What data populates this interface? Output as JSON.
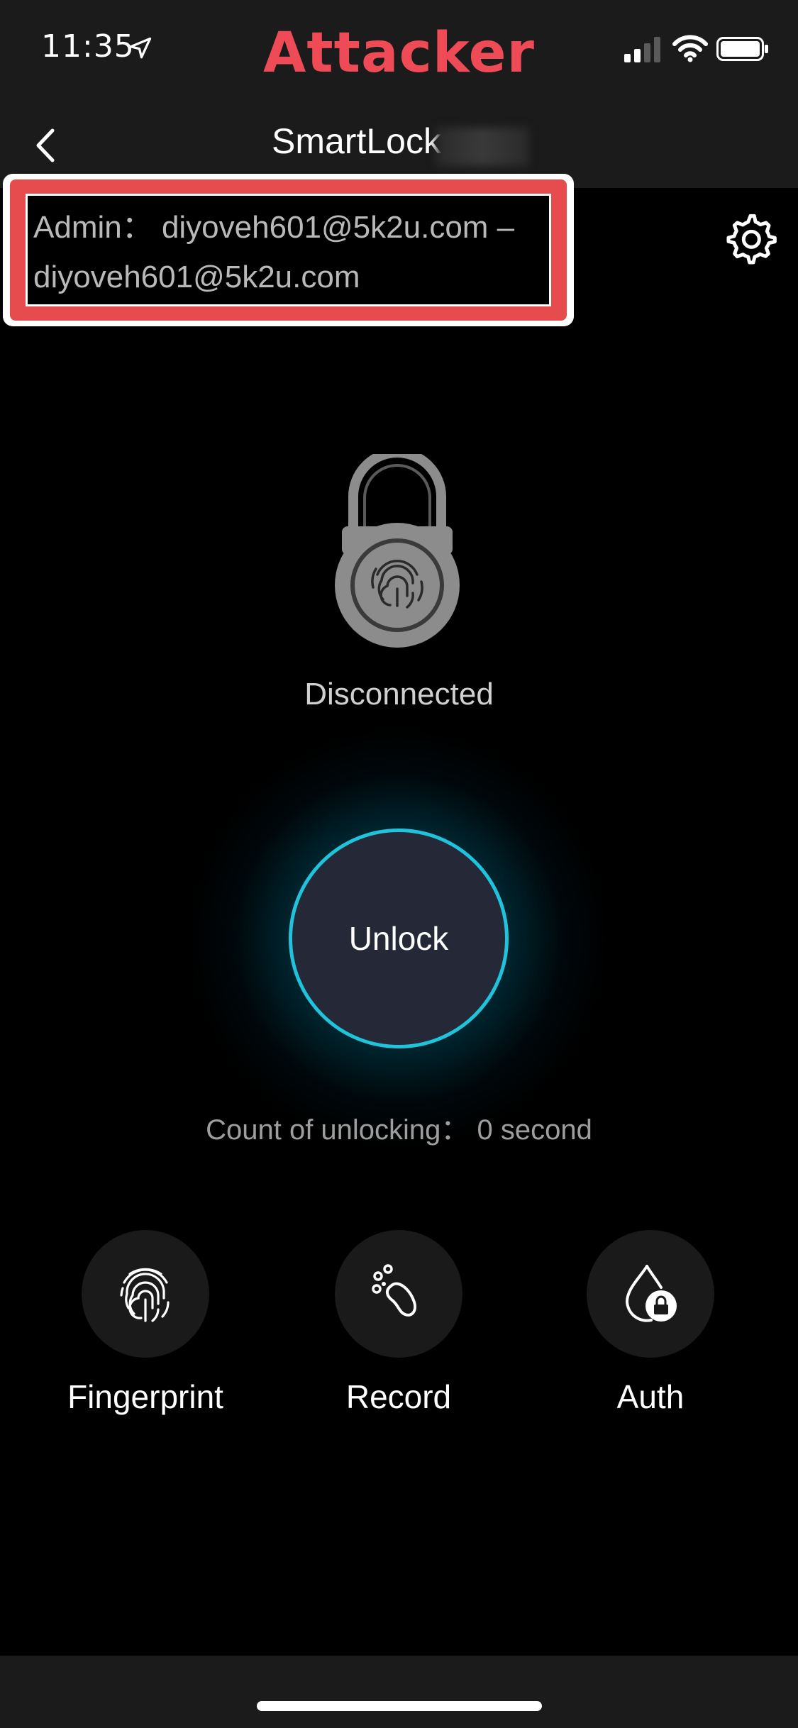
{
  "status_bar": {
    "time": "11:35",
    "overlay_title": "Attacker",
    "icons": [
      "location-arrow-icon",
      "cellular-signal-icon",
      "wifi-icon",
      "battery-icon"
    ]
  },
  "nav": {
    "back_icon": "chevron-left-icon",
    "title": "SmartLock"
  },
  "admin": {
    "text": "Admin： diyoveh601@5k2u.com – diyoveh601@5k2u.com"
  },
  "settings_icon": "gear-icon",
  "lock": {
    "icon": "padlock-fingerprint-icon",
    "status": "Disconnected"
  },
  "unlock": {
    "label": "Unlock",
    "count_text": "Count of unlocking： 0 second"
  },
  "actions": [
    {
      "label": "Fingerprint",
      "icon": "fingerprint-icon"
    },
    {
      "label": "Record",
      "icon": "footprint-icon"
    },
    {
      "label": "Auth",
      "icon": "drop-lock-icon"
    }
  ],
  "colors": {
    "accent": "#1fc4dc",
    "overlay_title": "#ef4b57",
    "highlight_border": "#e64b4e",
    "background": "#000000",
    "bar_background": "#1b1b1b"
  }
}
